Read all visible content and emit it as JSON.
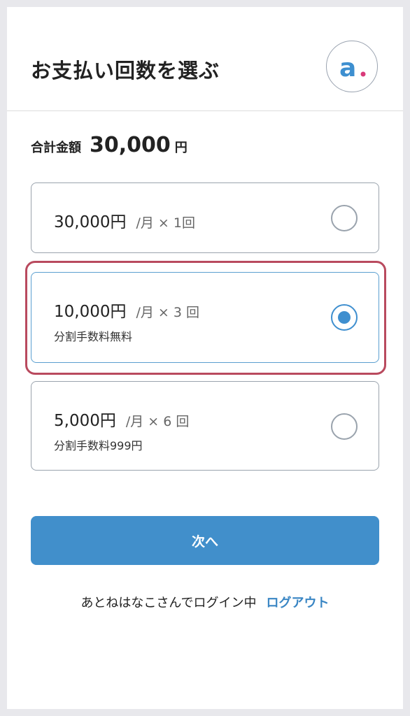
{
  "header": {
    "title": "お支払い回数を選ぶ",
    "logo_icon": "brand-logo-icon",
    "logo_letter": "a",
    "logo_colors": {
      "letter": "#3d8fd0",
      "dot": "#d93a7a"
    }
  },
  "total": {
    "label": "合計金額",
    "amount": "30,000",
    "unit": "円"
  },
  "options": [
    {
      "price": "30,000円",
      "per": "/月 × 1回",
      "note": "",
      "selected": false
    },
    {
      "price": "10,000円",
      "per": "/月 × 3 回",
      "note": "分割手数料無料",
      "selected": true
    },
    {
      "price": "5,000円",
      "per": "/月 × 6 回",
      "note": "分割手数料999円",
      "selected": false
    }
  ],
  "next_button": {
    "label": "次へ"
  },
  "login": {
    "status": "あとねはなこさんでログイン中",
    "logout_label": "ログアウト"
  },
  "colors": {
    "accent": "#418fcb",
    "highlight_border": "#b94a5e",
    "link": "#3a86c4"
  }
}
